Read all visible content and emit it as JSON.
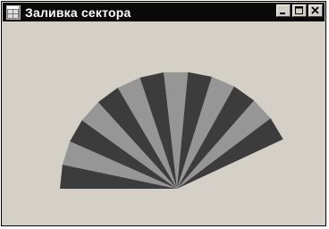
{
  "window": {
    "title": "Заливка сектора"
  },
  "icons": {
    "app": "application-icon",
    "minimize": "minimize-icon",
    "maximize": "maximize-icon",
    "close": "close-icon"
  },
  "drawing": {
    "shape": "sector",
    "wedge_count": 13,
    "start_angle_deg": 180,
    "sweep_deg": 155,
    "colors": [
      "#3c3c3c",
      "#969696"
    ]
  }
}
